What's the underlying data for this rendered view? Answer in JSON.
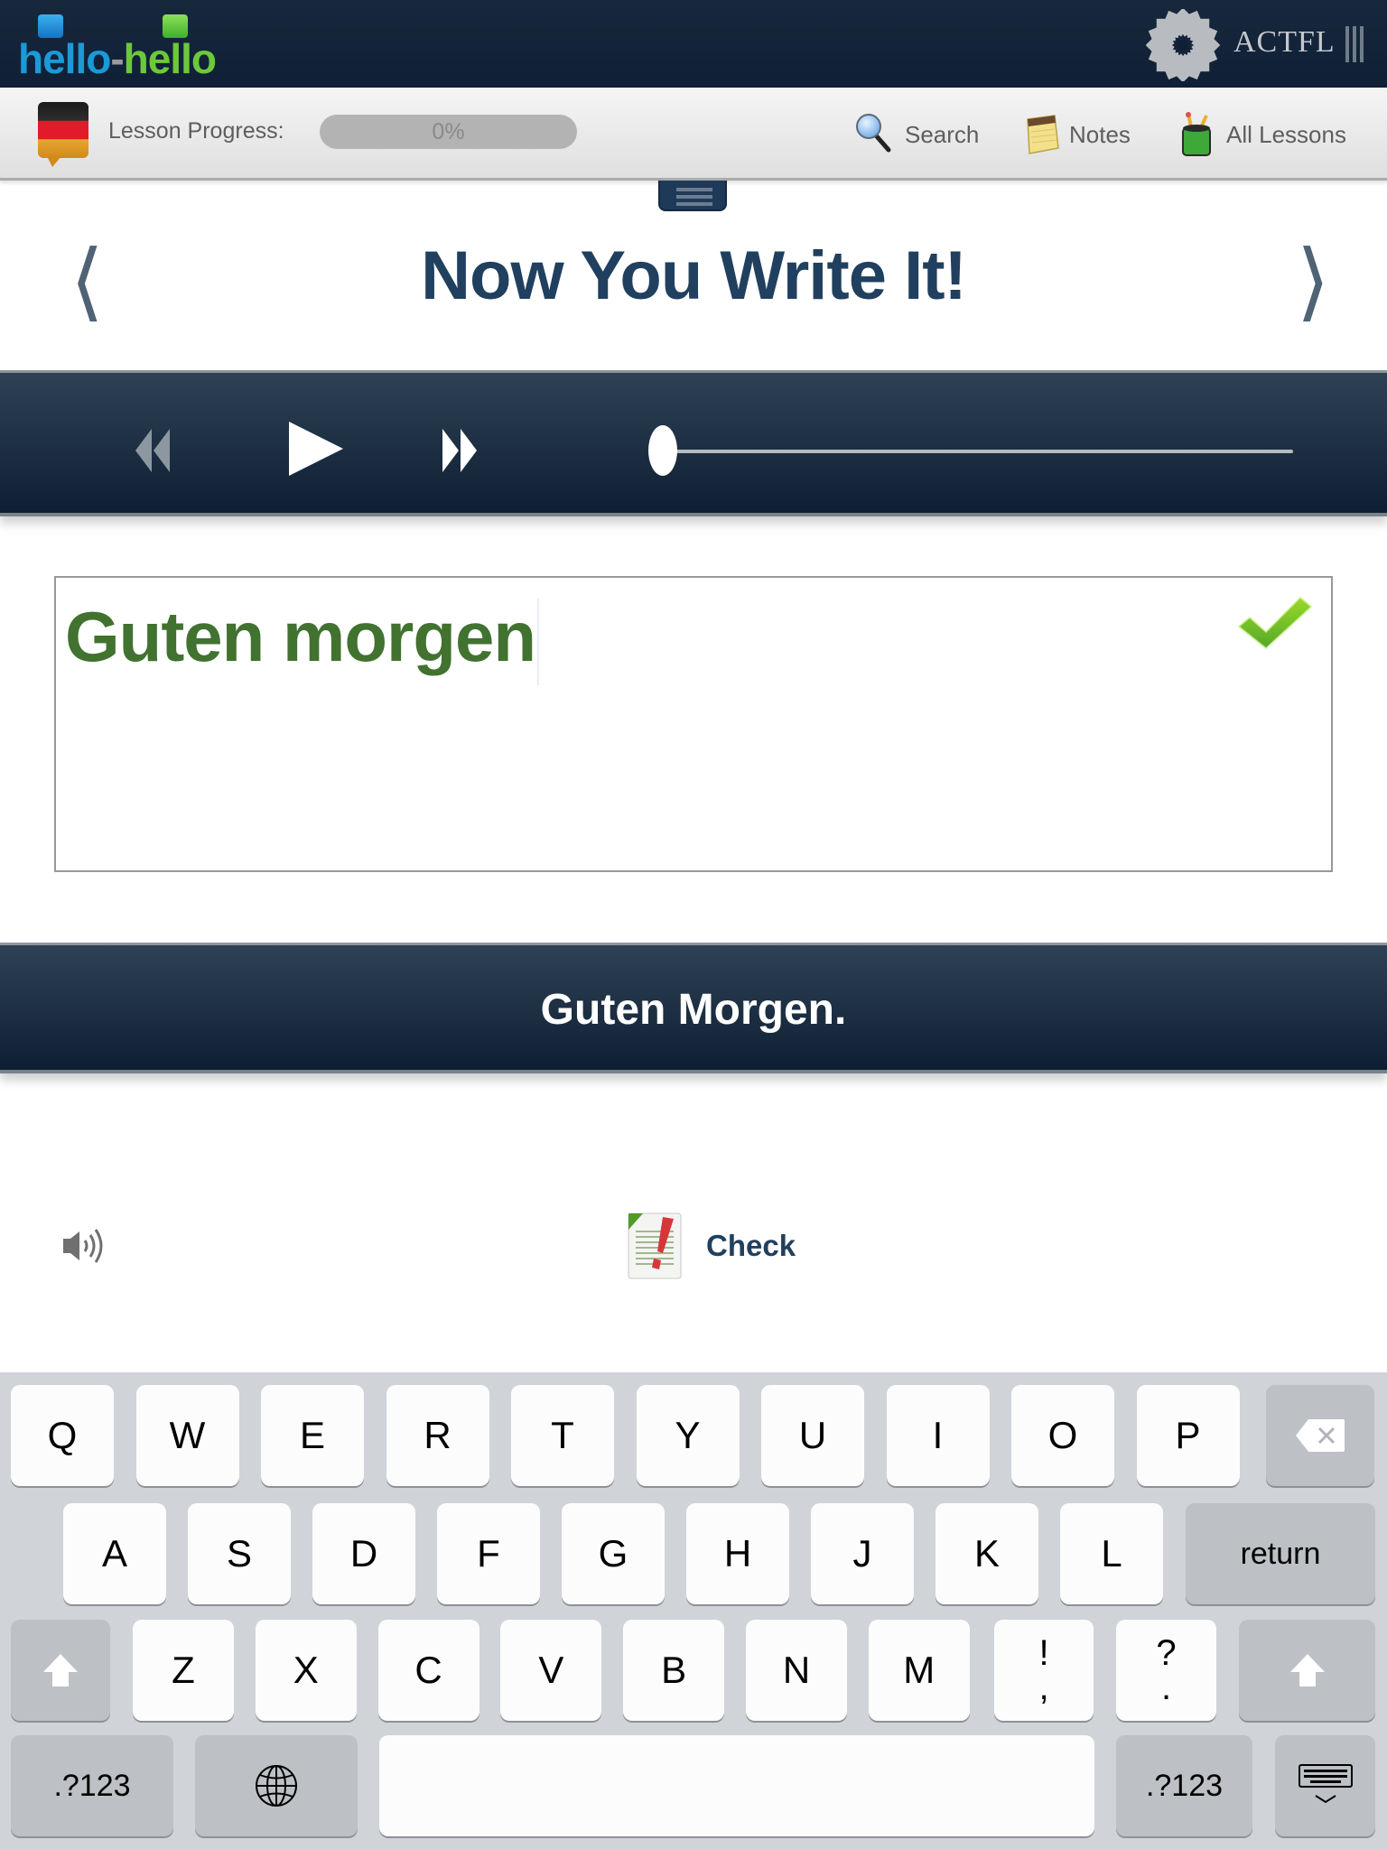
{
  "header": {
    "logo": {
      "part1": "hello",
      "dash": "-",
      "part2": "hello"
    },
    "partner": {
      "name": "ACTFL",
      "icon": "actfl-emblem-icon"
    }
  },
  "toolbar": {
    "language_flag": "german-flag-icon",
    "progress_label": "Lesson Progress:",
    "progress_percent": 0,
    "progress_text": "0%",
    "search_label": "Search",
    "notes_label": "Notes",
    "all_lessons_label": "All Lessons"
  },
  "exercise": {
    "title": "Now You Write It!",
    "prev_icon": "chevron-left-icon",
    "next_icon": "chevron-right-icon"
  },
  "player": {
    "rewind_icon": "rewind-icon",
    "play_icon": "play-icon",
    "fast_forward_icon": "fast-forward-icon",
    "position_fraction": 0
  },
  "answer": {
    "value": "Guten morgen",
    "status": "correct",
    "status_color": "#6cc93a",
    "text_color": "#417230"
  },
  "solution": {
    "text": "Guten Morgen."
  },
  "actions": {
    "speaker_icon": "speaker-icon",
    "check_label": "Check"
  },
  "keyboard": {
    "row1": [
      "Q",
      "W",
      "E",
      "R",
      "T",
      "Y",
      "U",
      "I",
      "O",
      "P"
    ],
    "row2": [
      "A",
      "S",
      "D",
      "F",
      "G",
      "H",
      "J",
      "K",
      "L"
    ],
    "row3": [
      "Z",
      "X",
      "C",
      "V",
      "B",
      "N",
      "M"
    ],
    "punct1": {
      "top": "!",
      "bottom": ","
    },
    "punct2": {
      "top": "?",
      "bottom": "."
    },
    "return_label": "return",
    "numbers_label": ".?123",
    "space_label": ""
  },
  "colors": {
    "header_bg": "#0f2036",
    "title_color": "#21405f",
    "accent_green": "#6cc93a"
  }
}
